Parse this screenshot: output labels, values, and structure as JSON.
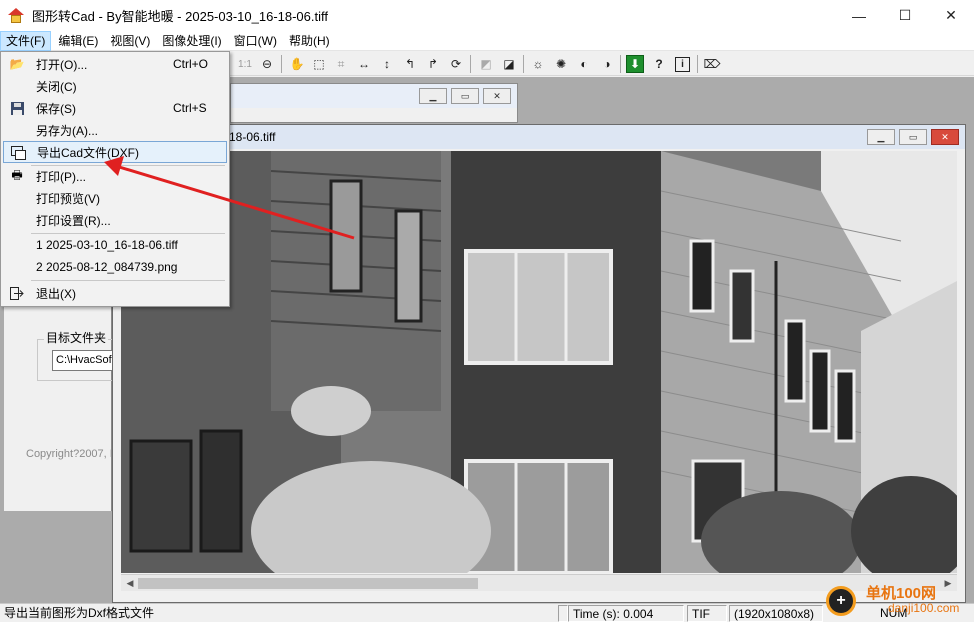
{
  "window": {
    "title": "图形转Cad  - By智能地暖 - 2025-03-10_16-18-06.tiff",
    "minimize": "—",
    "maximize": "☐",
    "close": "✕"
  },
  "menubar": [
    {
      "label": "文件(F)",
      "active": true
    },
    {
      "label": "编辑(E)"
    },
    {
      "label": "视图(V)"
    },
    {
      "label": "图像处理(I)"
    },
    {
      "label": "窗口(W)"
    },
    {
      "label": "帮助(H)"
    }
  ],
  "toolbar": {
    "icons": [
      "zoom-actual-icon",
      "zoom-out-icon",
      "pan-hand-icon",
      "select-rect-icon",
      "select-magic-icon",
      "flip-horizontal-icon",
      "flip-vertical-icon",
      "rotate-left-icon",
      "rotate-right-icon",
      "rotate-free-icon",
      "threshold-icon",
      "invert-icon",
      "sun-bright-icon",
      "sun-dim-icon",
      "contrast-icon",
      "exposure-icon",
      "export-download-icon",
      "help-icon",
      "info-icon",
      "tag-icon"
    ],
    "zoom_label": "1:1",
    "help_label": "?",
    "info_label": "i"
  },
  "file_menu": {
    "items": [
      {
        "label": "打开(O)...",
        "shortcut": "Ctrl+O",
        "icon": "folder-open-icon"
      },
      {
        "label": "关闭(C)"
      },
      {
        "label": "保存(S)",
        "shortcut": "Ctrl+S",
        "icon": "floppy-disk-icon"
      },
      {
        "label": "另存为(A)..."
      },
      {
        "label": "导出Cad文件(DXF)",
        "icon": "export-cad-icon",
        "highlighted": true
      },
      {
        "label": "打印(P)...",
        "icon": "printer-icon"
      },
      {
        "label": "打印预览(V)"
      },
      {
        "label": "打印设置(R)..."
      },
      {
        "label": "1 2025-03-10_16-18-06.tiff"
      },
      {
        "label": "2 2025-08-12_084739.png"
      },
      {
        "label": "退出(X)",
        "icon": "exit-icon"
      }
    ]
  },
  "left_panel": {
    "dest_folder_label": "目标文件夹",
    "dest_folder_value": "C:\\HvacSof",
    "copyright": "Copyright?2007, I"
  },
  "image_window": {
    "title": "18-06.tiff"
  },
  "statusbar": {
    "message": "导出当前图形为Dxf格式文件",
    "time": "Time (s): 0.004",
    "format": "TIF",
    "dimensions": "(1920x1080x8)",
    "num": "NUM"
  },
  "watermark": {
    "text": "单机100网",
    "url": "danji100.com"
  },
  "colors": {
    "menu_highlight": "#cce8ff",
    "item_highlight_border": "#7aa7d6",
    "arrow": "#e02020",
    "close_red": "#d84a3c",
    "watermark_orange": "#e87511"
  }
}
